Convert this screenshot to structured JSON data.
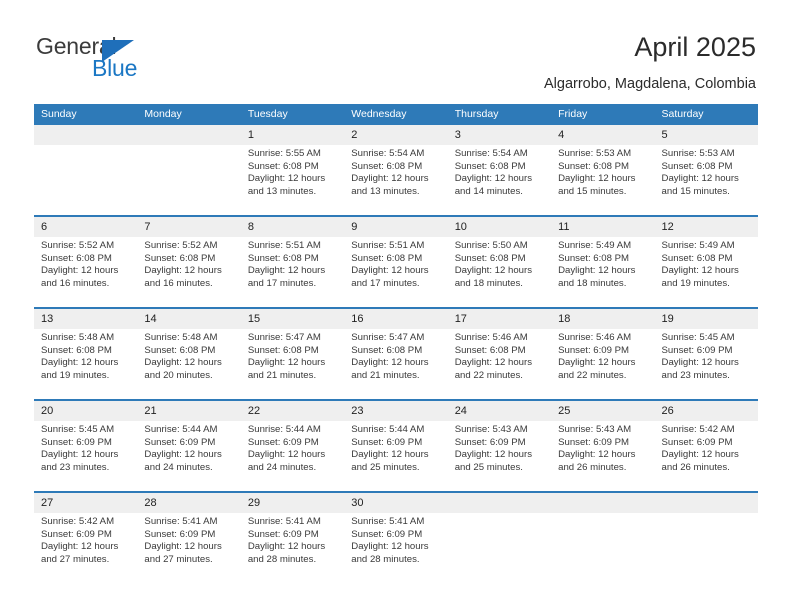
{
  "brand": {
    "name_top": "General",
    "name_bottom": "Blue",
    "triangle_color": "#1f6fba",
    "text_color": "#1b77c4"
  },
  "header": {
    "title": "April 2025",
    "subtitle": "Algarrobo, Magdalena, Colombia"
  },
  "theme": {
    "header_blue": "#2e7ab8",
    "daynum_band": "#efefef",
    "text": "#3a3a3a"
  },
  "weekday_headers": [
    "Sunday",
    "Monday",
    "Tuesday",
    "Wednesday",
    "Thursday",
    "Friday",
    "Saturday"
  ],
  "weeks": [
    [
      {
        "day": "",
        "sunrise": "",
        "sunset": "",
        "daylight_l1": "",
        "daylight_l2": ""
      },
      {
        "day": "",
        "sunrise": "",
        "sunset": "",
        "daylight_l1": "",
        "daylight_l2": ""
      },
      {
        "day": "1",
        "sunrise": "Sunrise: 5:55 AM",
        "sunset": "Sunset: 6:08 PM",
        "daylight_l1": "Daylight: 12 hours",
        "daylight_l2": "and 13 minutes."
      },
      {
        "day": "2",
        "sunrise": "Sunrise: 5:54 AM",
        "sunset": "Sunset: 6:08 PM",
        "daylight_l1": "Daylight: 12 hours",
        "daylight_l2": "and 13 minutes."
      },
      {
        "day": "3",
        "sunrise": "Sunrise: 5:54 AM",
        "sunset": "Sunset: 6:08 PM",
        "daylight_l1": "Daylight: 12 hours",
        "daylight_l2": "and 14 minutes."
      },
      {
        "day": "4",
        "sunrise": "Sunrise: 5:53 AM",
        "sunset": "Sunset: 6:08 PM",
        "daylight_l1": "Daylight: 12 hours",
        "daylight_l2": "and 15 minutes."
      },
      {
        "day": "5",
        "sunrise": "Sunrise: 5:53 AM",
        "sunset": "Sunset: 6:08 PM",
        "daylight_l1": "Daylight: 12 hours",
        "daylight_l2": "and 15 minutes."
      }
    ],
    [
      {
        "day": "6",
        "sunrise": "Sunrise: 5:52 AM",
        "sunset": "Sunset: 6:08 PM",
        "daylight_l1": "Daylight: 12 hours",
        "daylight_l2": "and 16 minutes."
      },
      {
        "day": "7",
        "sunrise": "Sunrise: 5:52 AM",
        "sunset": "Sunset: 6:08 PM",
        "daylight_l1": "Daylight: 12 hours",
        "daylight_l2": "and 16 minutes."
      },
      {
        "day": "8",
        "sunrise": "Sunrise: 5:51 AM",
        "sunset": "Sunset: 6:08 PM",
        "daylight_l1": "Daylight: 12 hours",
        "daylight_l2": "and 17 minutes."
      },
      {
        "day": "9",
        "sunrise": "Sunrise: 5:51 AM",
        "sunset": "Sunset: 6:08 PM",
        "daylight_l1": "Daylight: 12 hours",
        "daylight_l2": "and 17 minutes."
      },
      {
        "day": "10",
        "sunrise": "Sunrise: 5:50 AM",
        "sunset": "Sunset: 6:08 PM",
        "daylight_l1": "Daylight: 12 hours",
        "daylight_l2": "and 18 minutes."
      },
      {
        "day": "11",
        "sunrise": "Sunrise: 5:49 AM",
        "sunset": "Sunset: 6:08 PM",
        "daylight_l1": "Daylight: 12 hours",
        "daylight_l2": "and 18 minutes."
      },
      {
        "day": "12",
        "sunrise": "Sunrise: 5:49 AM",
        "sunset": "Sunset: 6:08 PM",
        "daylight_l1": "Daylight: 12 hours",
        "daylight_l2": "and 19 minutes."
      }
    ],
    [
      {
        "day": "13",
        "sunrise": "Sunrise: 5:48 AM",
        "sunset": "Sunset: 6:08 PM",
        "daylight_l1": "Daylight: 12 hours",
        "daylight_l2": "and 19 minutes."
      },
      {
        "day": "14",
        "sunrise": "Sunrise: 5:48 AM",
        "sunset": "Sunset: 6:08 PM",
        "daylight_l1": "Daylight: 12 hours",
        "daylight_l2": "and 20 minutes."
      },
      {
        "day": "15",
        "sunrise": "Sunrise: 5:47 AM",
        "sunset": "Sunset: 6:08 PM",
        "daylight_l1": "Daylight: 12 hours",
        "daylight_l2": "and 21 minutes."
      },
      {
        "day": "16",
        "sunrise": "Sunrise: 5:47 AM",
        "sunset": "Sunset: 6:08 PM",
        "daylight_l1": "Daylight: 12 hours",
        "daylight_l2": "and 21 minutes."
      },
      {
        "day": "17",
        "sunrise": "Sunrise: 5:46 AM",
        "sunset": "Sunset: 6:08 PM",
        "daylight_l1": "Daylight: 12 hours",
        "daylight_l2": "and 22 minutes."
      },
      {
        "day": "18",
        "sunrise": "Sunrise: 5:46 AM",
        "sunset": "Sunset: 6:09 PM",
        "daylight_l1": "Daylight: 12 hours",
        "daylight_l2": "and 22 minutes."
      },
      {
        "day": "19",
        "sunrise": "Sunrise: 5:45 AM",
        "sunset": "Sunset: 6:09 PM",
        "daylight_l1": "Daylight: 12 hours",
        "daylight_l2": "and 23 minutes."
      }
    ],
    [
      {
        "day": "20",
        "sunrise": "Sunrise: 5:45 AM",
        "sunset": "Sunset: 6:09 PM",
        "daylight_l1": "Daylight: 12 hours",
        "daylight_l2": "and 23 minutes."
      },
      {
        "day": "21",
        "sunrise": "Sunrise: 5:44 AM",
        "sunset": "Sunset: 6:09 PM",
        "daylight_l1": "Daylight: 12 hours",
        "daylight_l2": "and 24 minutes."
      },
      {
        "day": "22",
        "sunrise": "Sunrise: 5:44 AM",
        "sunset": "Sunset: 6:09 PM",
        "daylight_l1": "Daylight: 12 hours",
        "daylight_l2": "and 24 minutes."
      },
      {
        "day": "23",
        "sunrise": "Sunrise: 5:44 AM",
        "sunset": "Sunset: 6:09 PM",
        "daylight_l1": "Daylight: 12 hours",
        "daylight_l2": "and 25 minutes."
      },
      {
        "day": "24",
        "sunrise": "Sunrise: 5:43 AM",
        "sunset": "Sunset: 6:09 PM",
        "daylight_l1": "Daylight: 12 hours",
        "daylight_l2": "and 25 minutes."
      },
      {
        "day": "25",
        "sunrise": "Sunrise: 5:43 AM",
        "sunset": "Sunset: 6:09 PM",
        "daylight_l1": "Daylight: 12 hours",
        "daylight_l2": "and 26 minutes."
      },
      {
        "day": "26",
        "sunrise": "Sunrise: 5:42 AM",
        "sunset": "Sunset: 6:09 PM",
        "daylight_l1": "Daylight: 12 hours",
        "daylight_l2": "and 26 minutes."
      }
    ],
    [
      {
        "day": "27",
        "sunrise": "Sunrise: 5:42 AM",
        "sunset": "Sunset: 6:09 PM",
        "daylight_l1": "Daylight: 12 hours",
        "daylight_l2": "and 27 minutes."
      },
      {
        "day": "28",
        "sunrise": "Sunrise: 5:41 AM",
        "sunset": "Sunset: 6:09 PM",
        "daylight_l1": "Daylight: 12 hours",
        "daylight_l2": "and 27 minutes."
      },
      {
        "day": "29",
        "sunrise": "Sunrise: 5:41 AM",
        "sunset": "Sunset: 6:09 PM",
        "daylight_l1": "Daylight: 12 hours",
        "daylight_l2": "and 28 minutes."
      },
      {
        "day": "30",
        "sunrise": "Sunrise: 5:41 AM",
        "sunset": "Sunset: 6:09 PM",
        "daylight_l1": "Daylight: 12 hours",
        "daylight_l2": "and 28 minutes."
      },
      {
        "day": "",
        "sunrise": "",
        "sunset": "",
        "daylight_l1": "",
        "daylight_l2": ""
      },
      {
        "day": "",
        "sunrise": "",
        "sunset": "",
        "daylight_l1": "",
        "daylight_l2": ""
      },
      {
        "day": "",
        "sunrise": "",
        "sunset": "",
        "daylight_l1": "",
        "daylight_l2": ""
      }
    ]
  ]
}
